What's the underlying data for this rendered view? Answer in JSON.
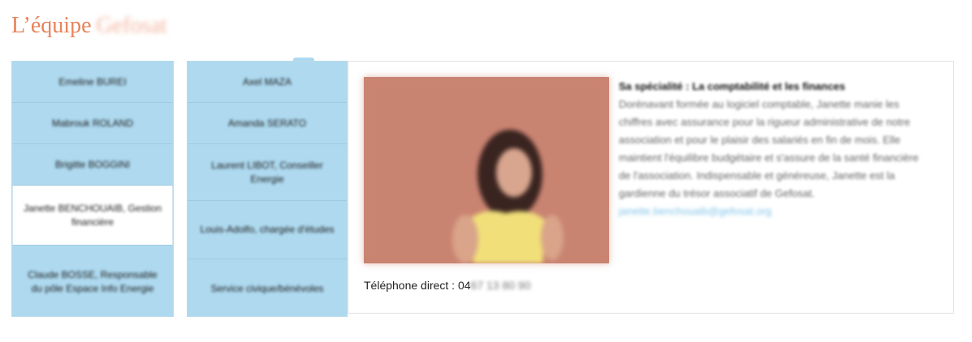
{
  "header": {
    "title": "L’équipe",
    "brand": "Gefosat"
  },
  "menu_col1": [
    {
      "label": "Emeline BUREI"
    },
    {
      "label": "Mabrouk ROLAND"
    },
    {
      "label": "Brigitte BOGGINI"
    },
    {
      "label": "Janette BENCHOUAIB, Gestion financière",
      "active": true
    },
    {
      "label": "Claude BOSSE, Responsable du pôle Espace Info Energie"
    }
  ],
  "menu_col2": [
    {
      "label": "Axel MAZA"
    },
    {
      "label": "Amanda SERATO"
    },
    {
      "label": "Laurent LIBOT, Conseiller Energie"
    },
    {
      "label": "Louis-Adolfo, chargée d'études"
    },
    {
      "label": "Service civique/bénévoles"
    }
  ],
  "profile": {
    "specialty": "Sa spécialité : La comptabilité et les finances",
    "bio": "Dorénavant formée au logiciel comptable, Janette manie les chiffres avec assurance pour la rigueur administrative de notre association et pour le plaisir des salariés en fin de mois. Elle maintient l'équilibre budgétaire et s'assure de la santé financière de l'association. Indispensable et généreuse, Janette est la gardienne du trésor associatif de Gefosat.",
    "email": "janette.benchouaib@gefosat.org",
    "phone_label": "Téléphone direct : 04",
    "phone_rest": " 67 13 80 90"
  },
  "colors": {
    "title": "#e8835a",
    "menu_bg": "#aed9ef",
    "active_bg": "#ffffff",
    "link": "#7ec2e8"
  }
}
